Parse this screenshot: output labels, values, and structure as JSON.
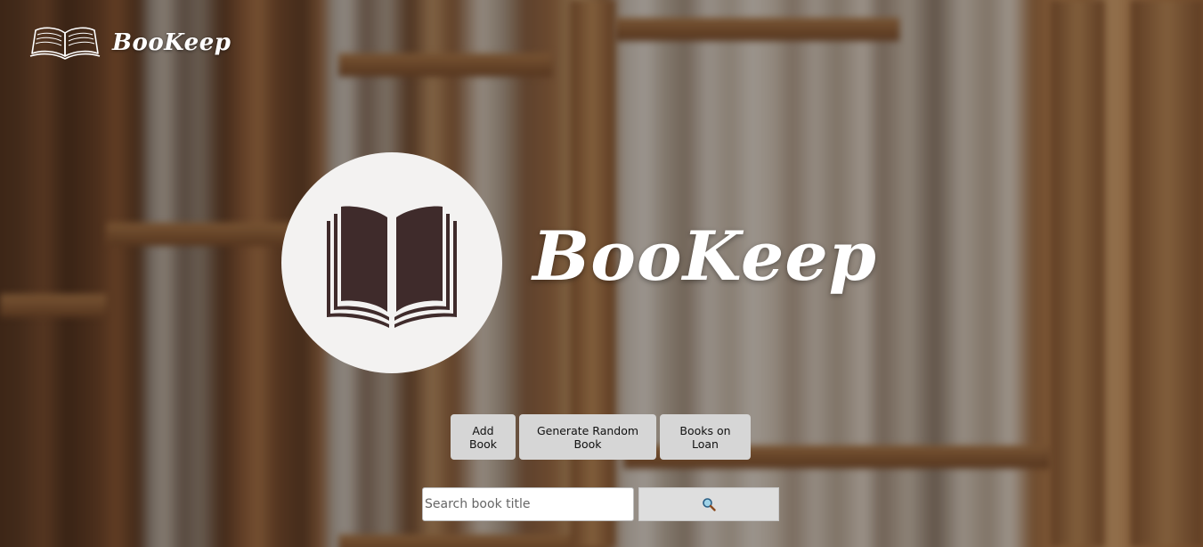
{
  "header": {
    "brand_name": "BooKeep",
    "logo_icon": "open-book-icon"
  },
  "hero": {
    "title": "BooKeep",
    "icon": "open-book-icon"
  },
  "actions": {
    "add_book_label": "Add Book",
    "random_book_label": "Generate Random Book",
    "books_on_loan_label": "Books on Loan"
  },
  "search": {
    "placeholder": "Search book title",
    "value": "",
    "button_icon": "search-icon"
  },
  "colors": {
    "button_bg": "#d6d6d6",
    "hero_circle": "#f3f2f1",
    "hero_icon": "#3f2b2b",
    "text_light": "#ffffff"
  }
}
